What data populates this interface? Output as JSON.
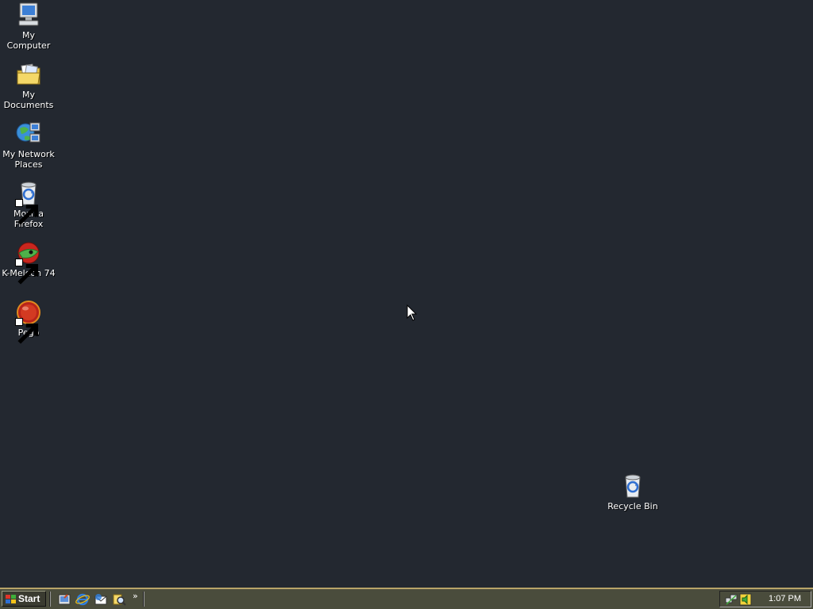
{
  "desktop": {
    "background_color": "#232830",
    "icons": [
      {
        "label": "My Computer",
        "icon": "computer-icon"
      },
      {
        "label": "My Documents",
        "icon": "folder-documents-icon"
      },
      {
        "label": "My Network Places",
        "icon": "network-places-icon"
      },
      {
        "label": "Mozilla Firefox",
        "icon": "firefox-icon"
      },
      {
        "label": "K-Meleon 74",
        "icon": "k-meleon-icon"
      },
      {
        "label": "Pego",
        "icon": "pego-icon"
      },
      {
        "label": "Recycle Bin",
        "icon": "recycle-bin-icon"
      }
    ]
  },
  "taskbar": {
    "start_label": "Start",
    "quick_launch": [
      "show-desktop-icon",
      "internet-explorer-icon",
      "outlook-express-icon",
      "search-icon"
    ],
    "chevron": "»",
    "tray": {
      "icons": [
        "network-tray-icon",
        "volume-tray-icon"
      ],
      "clock": "1:07 PM"
    },
    "accent_color": "#b8a468"
  }
}
